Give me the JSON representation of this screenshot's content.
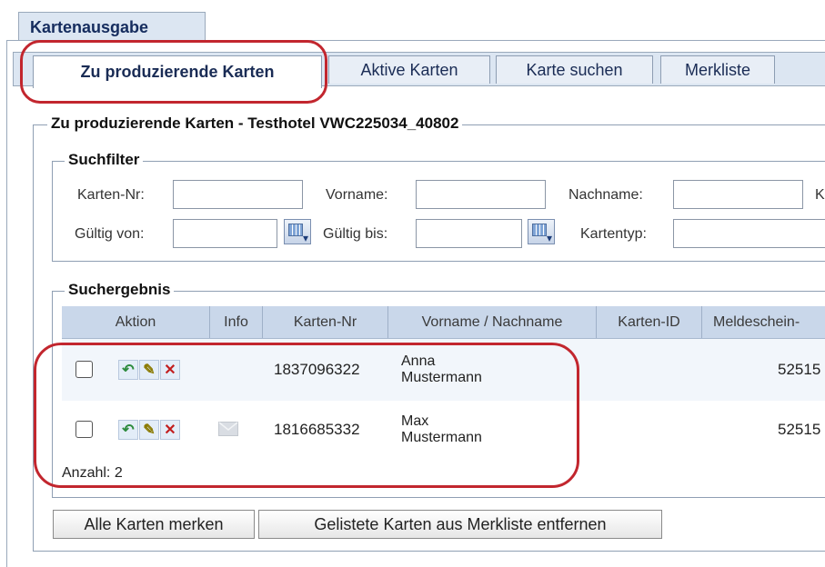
{
  "window": {
    "title": "Kartenausgabe"
  },
  "tabs": [
    {
      "label": "Zu produzierende Karten"
    },
    {
      "label": "Aktive Karten"
    },
    {
      "label": "Karte suchen"
    },
    {
      "label": "Merkliste"
    }
  ],
  "section": {
    "title": "Zu produzierende Karten - Testhotel VWC225034_40802"
  },
  "filter": {
    "title": "Suchfilter",
    "karten_nr_label": "Karten-Nr:",
    "vorname_label": "Vorname:",
    "nachname_label": "Nachname:",
    "truncated_label": "K",
    "gueltig_von_label": "Gültig von:",
    "gueltig_bis_label": "Gültig bis:",
    "kartentyp_label": "Kartentyp:",
    "karten_nr_value": "",
    "vorname_value": "",
    "nachname_value": "",
    "gueltig_von_value": "",
    "gueltig_bis_value": "",
    "kartentyp_value": ""
  },
  "results": {
    "title": "Suchergebnis",
    "columns": [
      "Aktion",
      "Info",
      "Karten-Nr",
      "Vorname / Nachname",
      "Karten-ID",
      "Meldeschein-"
    ],
    "rows": [
      {
        "karten_nr": "1837096322",
        "vorname": "Anna",
        "nachname": "Mustermann",
        "meldeschein": "52515"
      },
      {
        "karten_nr": "1816685332",
        "vorname": "Max",
        "nachname": "Mustermann",
        "meldeschein": "52515"
      }
    ],
    "count_label": "Anzahl: 2"
  },
  "buttons": {
    "remember_all": "Alle Karten merken",
    "remove_listed": "Gelistete Karten aus Merkliste entfernen"
  },
  "icons": {
    "reactivate": "reactivate-icon",
    "edit": "pencil-icon",
    "delete": "delete-icon",
    "info": "envelope-icon",
    "calendar": "calendar-icon"
  },
  "colors": {
    "highlight": "#c2262e",
    "header_bg": "#c9d7ea",
    "tab_bg": "#dce6f2",
    "title": "#152c5e"
  }
}
